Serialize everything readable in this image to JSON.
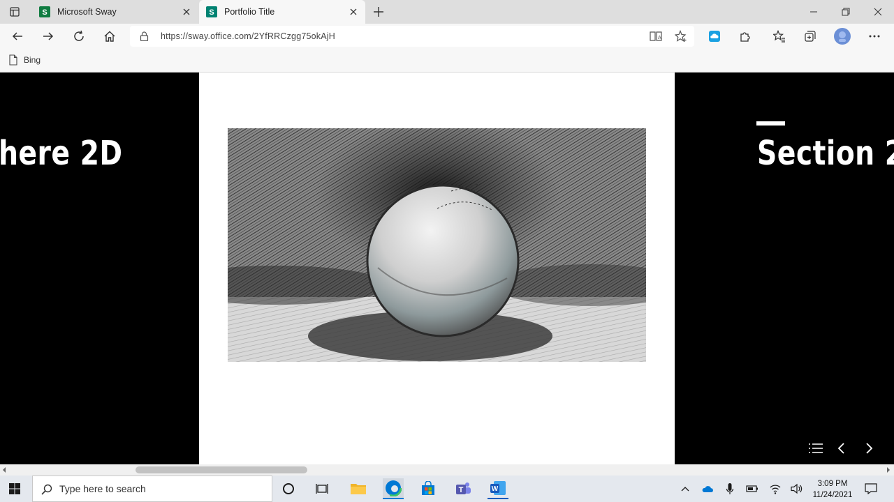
{
  "tabs": [
    {
      "title": "Microsoft Sway",
      "favicon": "sway-icon"
    },
    {
      "title": "Portfolio Title",
      "favicon": "sway-icon",
      "active": true
    }
  ],
  "address": {
    "url": "https://sway.office.com/2YfRRCzgg75okAjH"
  },
  "favorites": [
    {
      "label": "Bing"
    }
  ],
  "slides": {
    "left_heading": "here 2D",
    "right_heading": "Section 2"
  },
  "taskbar": {
    "search_placeholder": "Type here to search",
    "time": "3:09 PM",
    "date": "11/24/2021"
  },
  "colors": {
    "sway_green": "#107C41",
    "sway_teal": "#008272",
    "edge_blue": "#0078D4",
    "word_blue": "#185ABD",
    "teams_purple": "#5558AF"
  }
}
